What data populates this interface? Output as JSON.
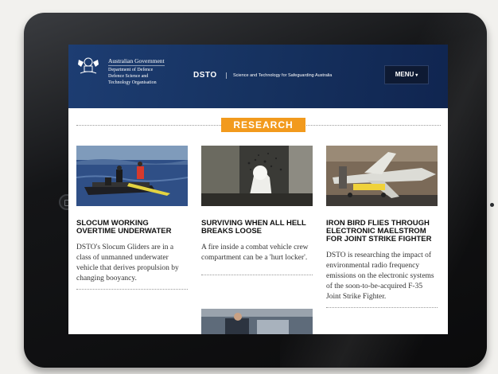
{
  "header": {
    "gov_line1": "Australian Government",
    "gov_line2": "Department of Defence",
    "gov_line3": "Defence Science and",
    "gov_line4": "Technology Organisation",
    "brand": "DSTO",
    "tagline": "Science and Technology for Safeguarding Australia",
    "menu_label": "MENU"
  },
  "section": {
    "label": "RESEARCH"
  },
  "articles": [
    {
      "title": "SLOCUM WORKING OVERTIME UNDERWATER",
      "body": "DSTO's Slocum Gliders are in a class of unmanned underwater vehicle that derives propulsion by changing booyancy."
    },
    {
      "title": "SURVIVING WHEN ALL HELL BREAKS LOOSE",
      "body": "A fire inside a combat vehicle crew compartment can be a 'hurt locker'."
    },
    {
      "title": "IRON BIRD FLIES THROUGH ELECTRONIC MAELSTROM FOR JOINT STRIKE FIGHTER",
      "body": "DSTO is researching the impact of environmental radio frequency emissions on the electronic systems of the soon-to-be-acquired F-35 Joint Strike Fighter."
    }
  ],
  "colors": {
    "header": "#163260",
    "accent": "#f29a1d",
    "bezel": "#111214"
  }
}
